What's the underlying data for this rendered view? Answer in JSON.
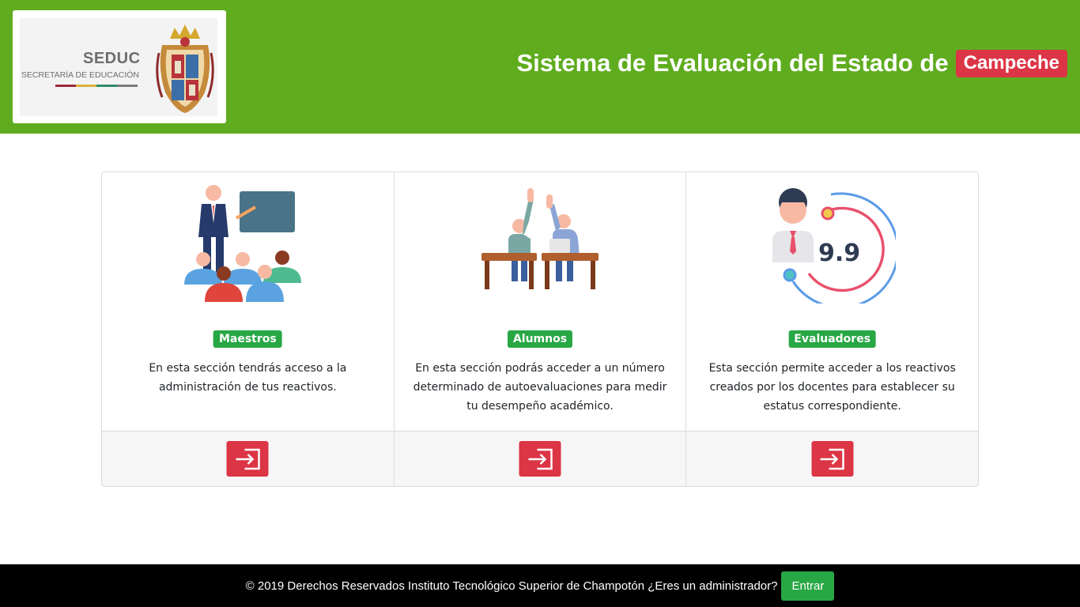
{
  "header": {
    "logo": {
      "org_short": "SEDUC",
      "org_full": "SECRETARÍA DE EDUCACIÓN",
      "bar_colors": [
        "#9a2a3a",
        "#d9b23a",
        "#2f8c6a",
        "#7a7a7a"
      ]
    },
    "title": "Sistema de Evaluación del Estado de",
    "state": "Campeche"
  },
  "cards": [
    {
      "label": "Maestros",
      "description": "En esta sección tendrás acceso a la administración de tus reactivos.",
      "icon": "teacher-classroom-icon",
      "action_icon": "sign-in-icon"
    },
    {
      "label": "Alumnos",
      "description": "En esta sección podrás acceder a un número determinado de autoevaluaciones para medir tu desempeño académico.",
      "icon": "students-raising-hands-icon",
      "action_icon": "sign-in-icon"
    },
    {
      "label": "Evaluadores",
      "description": "Esta sección permite acceder a los reactivos creados por los docentes para establecer su estatus correspondiente.",
      "icon": "evaluator-score-icon",
      "score": "9.9",
      "action_icon": "sign-in-icon"
    }
  ],
  "footer": {
    "text": "© 2019 Derechos Reservados Instituto Tecnológico Superior de Champotón ¿Eres un administrador?",
    "admin_button": "Entrar"
  },
  "colors": {
    "header_green": "#5fac1f",
    "badge_green": "#28a745",
    "accent_red": "#dc3545",
    "footer_bg": "#000000"
  }
}
